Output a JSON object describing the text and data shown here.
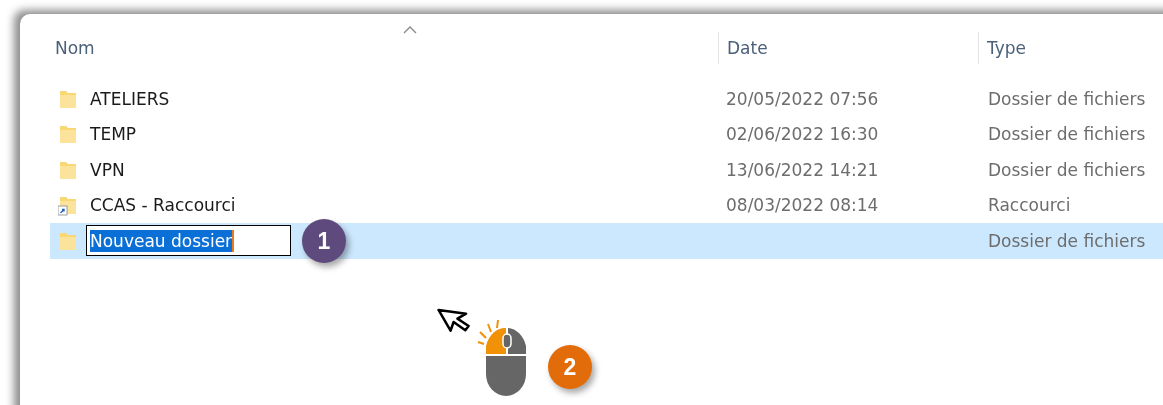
{
  "columns": [
    {
      "label": "Nom",
      "sorted": true
    },
    {
      "label": "Date",
      "sorted": false
    },
    {
      "label": "Type",
      "sorted": false
    }
  ],
  "rows": [
    {
      "kind": "folder",
      "name": "ATELIERS",
      "date": "20/05/2022 07:56",
      "type": "Dossier de fichiers",
      "selected": false,
      "editing": false
    },
    {
      "kind": "folder",
      "name": "TEMP",
      "date": "02/06/2022 16:30",
      "type": "Dossier de fichiers",
      "selected": false,
      "editing": false
    },
    {
      "kind": "folder",
      "name": "VPN",
      "date": "13/06/2022 14:21",
      "type": "Dossier de fichiers",
      "selected": false,
      "editing": false
    },
    {
      "kind": "shortcut",
      "name": "CCAS - Raccourci",
      "date": "08/03/2022 08:14",
      "type": "Raccourci",
      "selected": false,
      "editing": false
    },
    {
      "kind": "folder",
      "name": "Nouveau dossier",
      "type": "Dossier de fichiers",
      "selected": true,
      "editing": true
    }
  ],
  "callouts": [
    {
      "label": "1",
      "color": "#5e4a7d"
    },
    {
      "label": "2",
      "color": "#e36c0a"
    }
  ]
}
